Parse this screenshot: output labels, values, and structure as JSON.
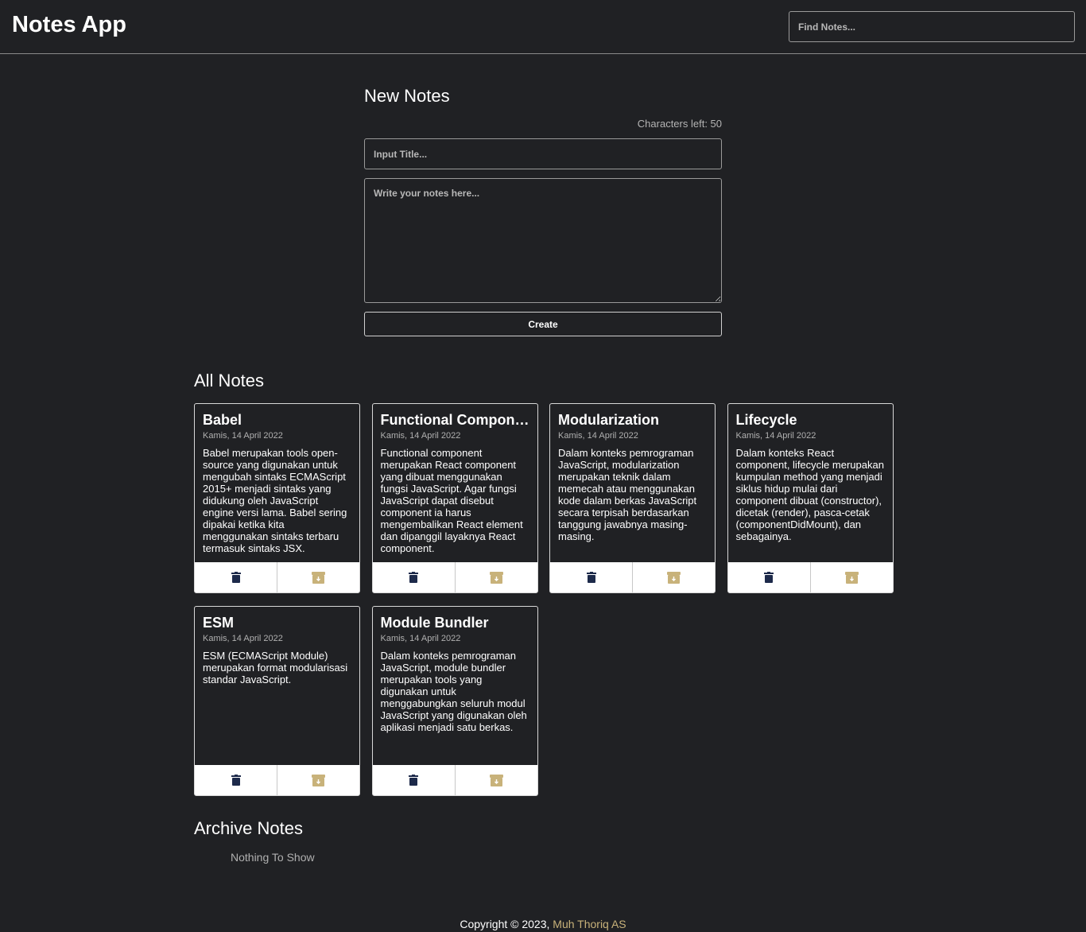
{
  "header": {
    "title": "Notes App",
    "search_placeholder": "Find Notes..."
  },
  "new_note": {
    "heading": "New Notes",
    "chars_left": "Characters left: 50",
    "title_placeholder": "Input Title...",
    "body_placeholder": "Write your notes here...",
    "create_label": "Create"
  },
  "all_notes": {
    "heading": "All Notes",
    "notes": [
      {
        "title": "Babel",
        "date": "Kamis, 14 April 2022",
        "body": "Babel merupakan tools open-source yang digunakan untuk mengubah sintaks ECMAScript 2015+ menjadi sintaks yang didukung oleh JavaScript engine versi lama. Babel sering dipakai ketika kita menggunakan sintaks terbaru termasuk sintaks JSX."
      },
      {
        "title": "Functional Component",
        "date": "Kamis, 14 April 2022",
        "body": "Functional component merupakan React component yang dibuat menggunakan fungsi JavaScript. Agar fungsi JavaScript dapat disebut component ia harus mengembalikan React element dan dipanggil layaknya React component."
      },
      {
        "title": "Modularization",
        "date": "Kamis, 14 April 2022",
        "body": "Dalam konteks pemrograman JavaScript, modularization merupakan teknik dalam memecah atau menggunakan kode dalam berkas JavaScript secara terpisah berdasarkan tanggung jawabnya masing-masing."
      },
      {
        "title": "Lifecycle",
        "date": "Kamis, 14 April 2022",
        "body": "Dalam konteks React component, lifecycle merupakan kumpulan method yang menjadi siklus hidup mulai dari component dibuat (constructor), dicetak (render), pasca-cetak (componentDidMount), dan sebagainya."
      },
      {
        "title": "ESM",
        "date": "Kamis, 14 April 2022",
        "body": "ESM (ECMAScript Module) merupakan format modularisasi standar JavaScript."
      },
      {
        "title": "Module Bundler",
        "date": "Kamis, 14 April 2022",
        "body": "Dalam konteks pemrograman JavaScript, module bundler merupakan tools yang digunakan untuk menggabungkan seluruh modul JavaScript yang digunakan oleh aplikasi menjadi satu berkas."
      }
    ]
  },
  "archive": {
    "heading": "Archive Notes",
    "empty_text": "Nothing To Show"
  },
  "footer": {
    "text": "Copyright © 2023,",
    "author": "Muh Thoriq AS"
  },
  "colors": {
    "background": "#202124",
    "delete_icon": "#1d2a4a",
    "archive_icon": "#c8b27a",
    "author_link": "#c8b27a"
  },
  "icons": {
    "delete": "trash-icon",
    "archive": "archive-box-icon"
  }
}
